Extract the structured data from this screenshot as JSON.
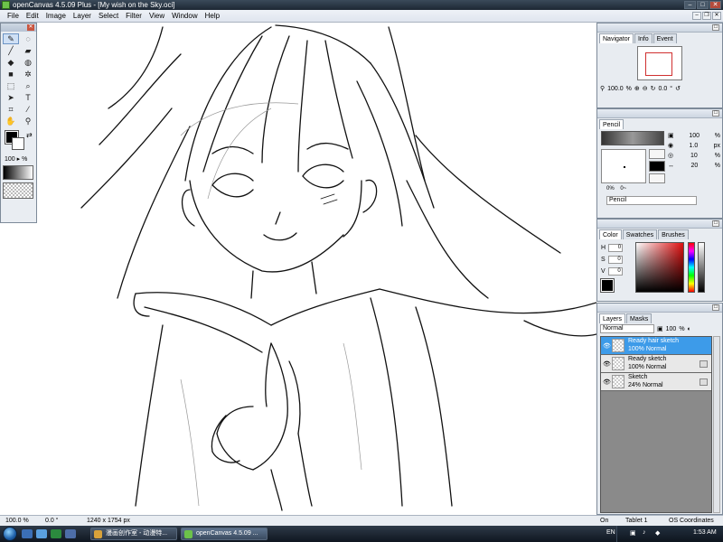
{
  "window": {
    "title": "openCanvas 4.5.09 Plus - [My wish on the Sky.oci]"
  },
  "menu": [
    "File",
    "Edit",
    "Image",
    "Layer",
    "Select",
    "Filter",
    "View",
    "Window",
    "Help"
  ],
  "toolbox": {
    "tools": [
      "pen-tool",
      "lasso-tool",
      "brush-tool",
      "eraser-tool",
      "fill-tool",
      "airbrush-tool",
      "shape-tool",
      "blur-tool",
      "select-tool",
      "zoom-tool",
      "move-tool",
      "text-tool",
      "crop-tool",
      "eyedropper-tool",
      "hand-tool",
      "magnifier-tool"
    ],
    "opacity": "100",
    "opacity_unit": "%"
  },
  "navigator": {
    "tabs": [
      "Navigator",
      "Info",
      "Event"
    ],
    "zoom": "100.0",
    "zoom_unit": "%",
    "rotation": "0.0",
    "rotation_unit": "°"
  },
  "pencil": {
    "tab": "Pencil",
    "opacity": "100",
    "opacity_unit": "%",
    "size": "1.0",
    "size_unit": "px",
    "density": "10",
    "density_unit": "%",
    "min": "20",
    "min_unit": "%",
    "pressure_min": "0%",
    "pressure_max": "0~",
    "name": "Pencil"
  },
  "color": {
    "tabs": [
      "Color",
      "Swatches",
      "Brushes"
    ],
    "h_label": "H",
    "h_value": "0",
    "s_label": "S",
    "s_value": "0",
    "v_label": "V",
    "v_value": "0",
    "current": "#000000"
  },
  "layers": {
    "tabs": [
      "Layers",
      "Masks"
    ],
    "blend_mode": "Normal",
    "opacity": "100",
    "opacity_unit": "%",
    "items": [
      {
        "name": "Ready hair sketch",
        "mode": "100% Normal",
        "selected": true
      },
      {
        "name": "Ready sketch",
        "mode": "100% Normal",
        "selected": false
      },
      {
        "name": "Sketch",
        "mode": "24% Normal",
        "selected": false
      }
    ]
  },
  "status": {
    "zoom": "100.0 %",
    "angle": "0.0 °",
    "size": "1240 x 1754 px",
    "on": "On",
    "tablet": "Tablet 1",
    "coords": "OS Coordinates"
  },
  "taskbar": {
    "tasks": [
      "漫画创作室 - 动漫特...",
      "openCanvas 4.5.09 ..."
    ],
    "lang": "EN",
    "time": "1:53 AM"
  }
}
